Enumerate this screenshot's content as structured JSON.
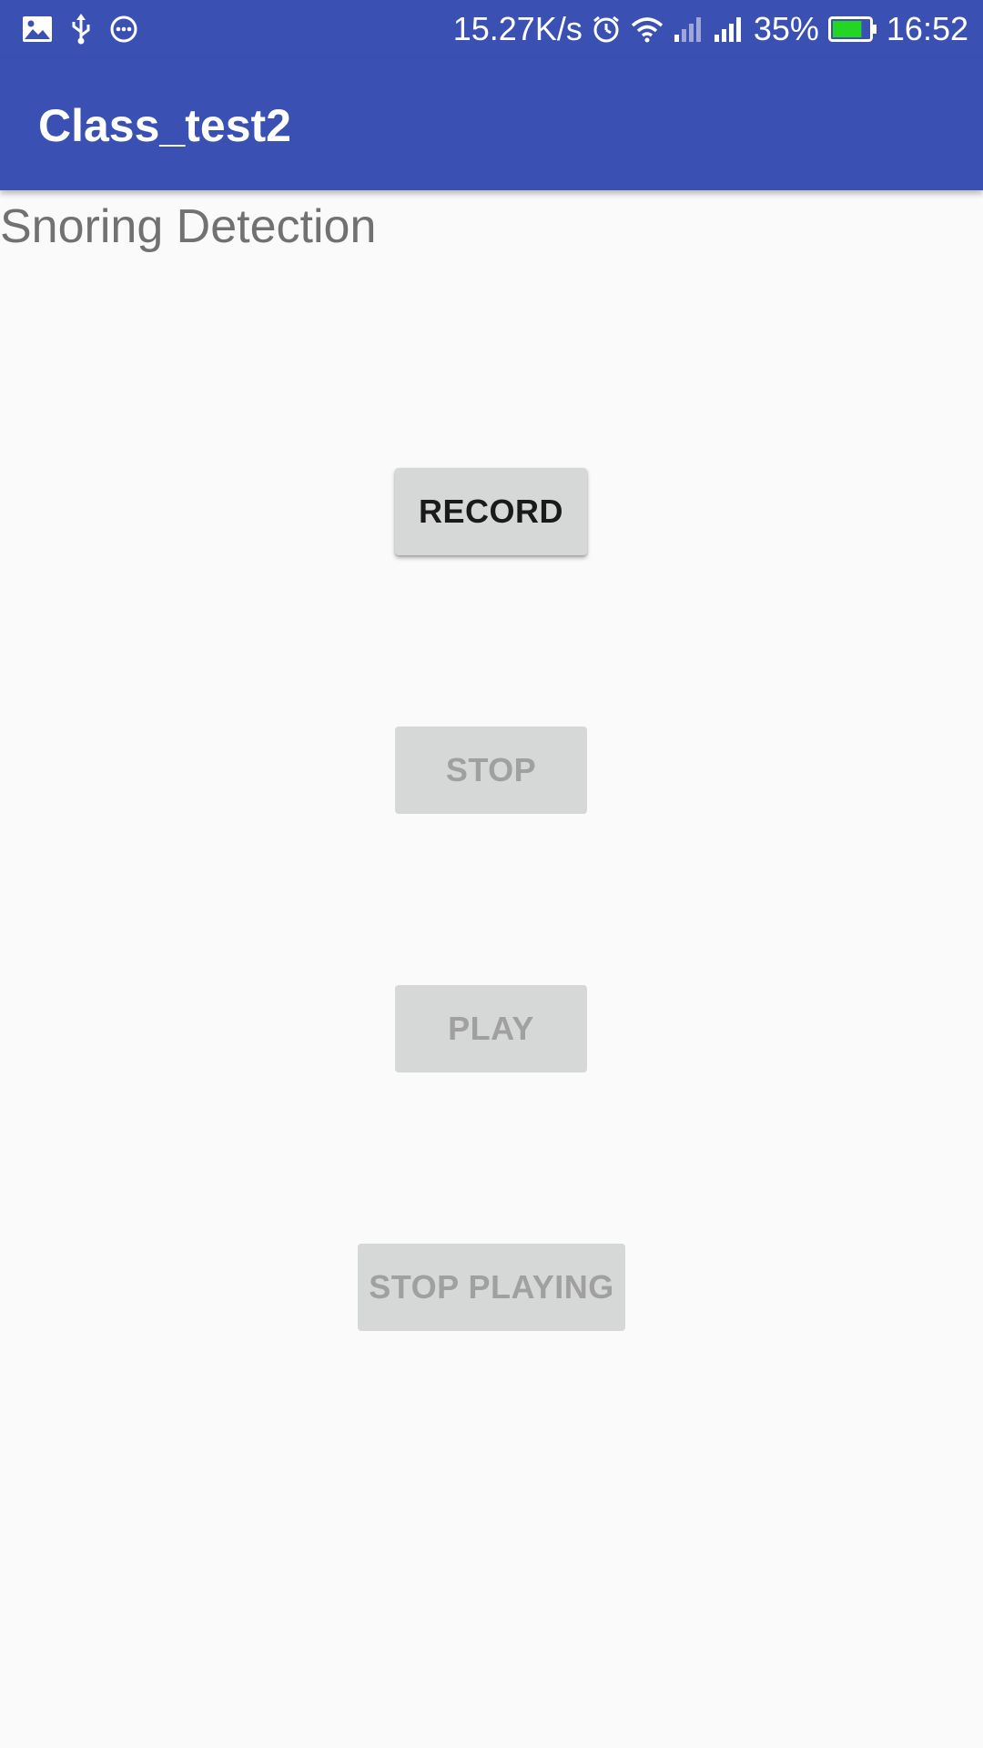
{
  "status_bar": {
    "left_icons": [
      "image-icon",
      "usb-icon",
      "more-dots-icon"
    ],
    "net_speed": "15.27K/s",
    "battery_percent": "35%",
    "battery_level": 0.35,
    "time": "16:52",
    "background_color": "#3a51b3"
  },
  "app_bar": {
    "title": "Class_test2",
    "background_color": "#3a51b3"
  },
  "screen": {
    "heading": "Snoring Detection"
  },
  "buttons": {
    "record": "RECORD",
    "stop": "STOP",
    "play": "PLAY",
    "stop_playing": "STOP PLAYING"
  }
}
